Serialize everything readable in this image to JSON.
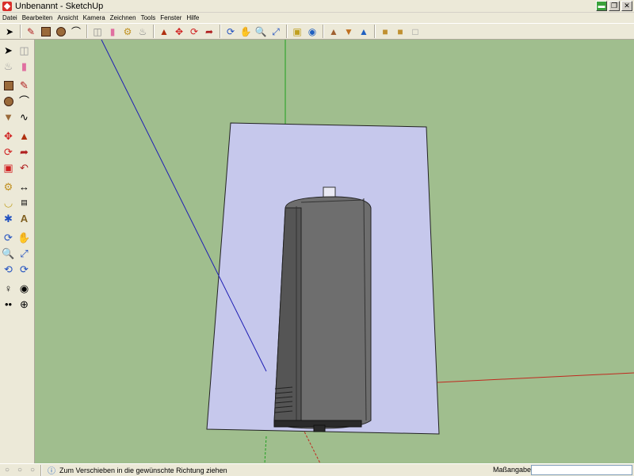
{
  "window": {
    "title": "Unbenannt - SketchUp"
  },
  "menu": {
    "items": [
      {
        "label": "Datei",
        "accel": "D"
      },
      {
        "label": "Bearbeiten",
        "accel": "B"
      },
      {
        "label": "Ansicht",
        "accel": "A"
      },
      {
        "label": "Kamera",
        "accel": "K"
      },
      {
        "label": "Zeichnen",
        "accel": "Z"
      },
      {
        "label": "Tools",
        "accel": "T"
      },
      {
        "label": "Fenster",
        "accel": "F"
      },
      {
        "label": "Hilfe",
        "accel": "H"
      }
    ]
  },
  "toolbar_top": {
    "tools": [
      {
        "icon": "select-arrow-icon"
      },
      {
        "icon": "pencil-line-icon"
      },
      {
        "icon": "rectangle-icon"
      },
      {
        "icon": "circle-icon"
      },
      {
        "icon": "arc-icon"
      },
      {
        "icon": "make-component-icon"
      },
      {
        "icon": "eraser-icon"
      },
      {
        "icon": "tape-measure-icon"
      },
      {
        "icon": "paint-bucket-icon"
      },
      {
        "icon": "push-pull-icon"
      },
      {
        "icon": "move-icon"
      },
      {
        "icon": "rotate-icon"
      },
      {
        "icon": "follow-me-icon"
      },
      {
        "icon": "orbit-icon"
      },
      {
        "icon": "pan-icon"
      },
      {
        "icon": "zoom-icon"
      },
      {
        "icon": "zoom-extents-icon"
      },
      {
        "icon": "get-current-view-icon"
      },
      {
        "icon": "add-location-icon"
      },
      {
        "icon": "toggle-terrain-icon"
      },
      {
        "icon": "get-models-icon"
      },
      {
        "icon": "share-model-icon"
      },
      {
        "icon": "share-component-icon"
      },
      {
        "icon": "get-photo-texture-icon"
      }
    ]
  },
  "toolbar_left": {
    "tools": [
      {
        "icon": "select-arrow-icon"
      },
      {
        "icon": "make-component-icon"
      },
      {
        "icon": "paint-bucket-icon"
      },
      {
        "icon": "eraser-icon"
      },
      {
        "icon": "rectangle-icon"
      },
      {
        "icon": "pencil-line-icon"
      },
      {
        "icon": "circle-icon"
      },
      {
        "icon": "arc-icon"
      },
      {
        "icon": "polygon-icon"
      },
      {
        "icon": "freehand-icon"
      },
      {
        "icon": "move-icon"
      },
      {
        "icon": "push-pull-icon"
      },
      {
        "icon": "rotate-icon"
      },
      {
        "icon": "follow-me-icon"
      },
      {
        "icon": "scale-icon"
      },
      {
        "icon": "offset-icon"
      },
      {
        "icon": "tape-measure-icon"
      },
      {
        "icon": "dimension-icon"
      },
      {
        "icon": "protractor-icon"
      },
      {
        "icon": "text-icon"
      },
      {
        "icon": "axes-icon"
      },
      {
        "icon": "3d-text-icon"
      },
      {
        "icon": "orbit-icon"
      },
      {
        "icon": "pan-icon"
      },
      {
        "icon": "zoom-icon"
      },
      {
        "icon": "zoom-window-icon"
      },
      {
        "icon": "previous-view-icon"
      },
      {
        "icon": "zoom-extents-icon"
      },
      {
        "icon": "position-camera-icon"
      },
      {
        "icon": "look-around-icon"
      },
      {
        "icon": "walk-icon"
      },
      {
        "icon": "section-plane-icon"
      }
    ]
  },
  "statusbar": {
    "message": "Zum Verschieben in die gewünschte Richtung ziehen",
    "measure_label": "Maßangaben",
    "measure_value": ""
  },
  "colors": {
    "viewport_bg": "#a0be8e",
    "plane_fill": "#c6c8ec",
    "model_dark": "#5e5e5e",
    "axis_red": "#c0281e",
    "axis_green": "#1ea01e",
    "axis_blue": "#1e1eb4"
  }
}
